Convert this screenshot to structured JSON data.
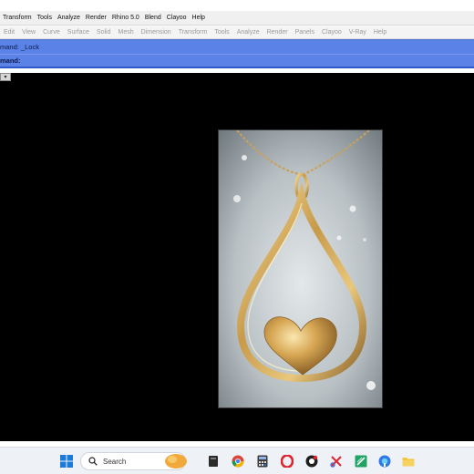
{
  "menubar": {
    "items": [
      "Transform",
      "Tools",
      "Analyze",
      "Render",
      "Rhino 5.0",
      "Blend",
      "Clayoo",
      "Help"
    ]
  },
  "toolbar_tabs": {
    "items": [
      "Edit",
      "View",
      "Curve",
      "Surface",
      "Solid",
      "Mesh",
      "Dimension",
      "Transform",
      "Tools",
      "Analyze",
      "Render",
      "Panels",
      "Clayoo",
      "V-Ray",
      "Help"
    ]
  },
  "command": {
    "history_text": "mand: _Lock",
    "prompt_label": "mand:",
    "input_value": ""
  },
  "viewport": {
    "control_glyph": "▾",
    "background": "#000000",
    "image_subject": "gold-teardrop-heart-pendant"
  },
  "taskbar": {
    "search_placeholder": "Search",
    "apps": [
      "start-icon",
      "search-icon",
      "widget-icon",
      "file-explorer-icon",
      "chrome-icon",
      "calculator-icon",
      "opera-icon",
      "app-icon",
      "snipping-icon",
      "spreadsheet-icon",
      "edge-icon",
      "folder-icon"
    ]
  },
  "colors": {
    "command_bar": "#5b82e6",
    "menubar": "#f0f0f0",
    "toolbar_text": "#9a9a9a",
    "taskbar": "#eef1f6"
  }
}
